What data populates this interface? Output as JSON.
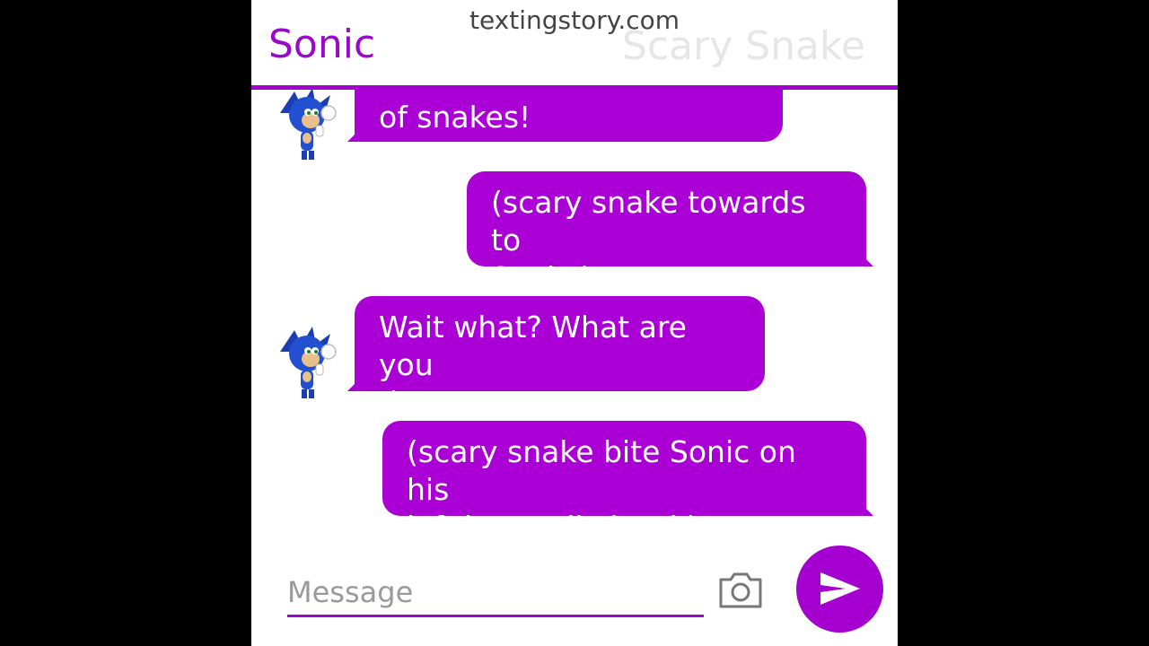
{
  "app": {
    "watermark": "textingstory.com"
  },
  "header": {
    "contact_name": "Sonic",
    "other_name": "Scary Snake"
  },
  "messages": [
    {
      "sender": "Sonic",
      "side": "left",
      "text_line1": "…",
      "text_line2": "of snakes!"
    },
    {
      "sender": "Scary Snake",
      "side": "right",
      "text_line1": "(scary snake towards to",
      "text_line2": "Sonic.)"
    },
    {
      "sender": "Sonic",
      "side": "left",
      "text_line1": "Wait what? What are you",
      "text_line2": "do-"
    },
    {
      "sender": "Scary Snake",
      "side": "right",
      "text_line1": "(scary snake bite Sonic on his",
      "text_line2": "left leg really hard.)"
    }
  ],
  "composer": {
    "placeholder": "Message",
    "camera_icon": "camera-icon",
    "send_icon": "send-icon"
  },
  "colors": {
    "accent": "#a400d0",
    "bubble": "#aa00d6",
    "background": "#ffffff",
    "outside": "#000000"
  }
}
